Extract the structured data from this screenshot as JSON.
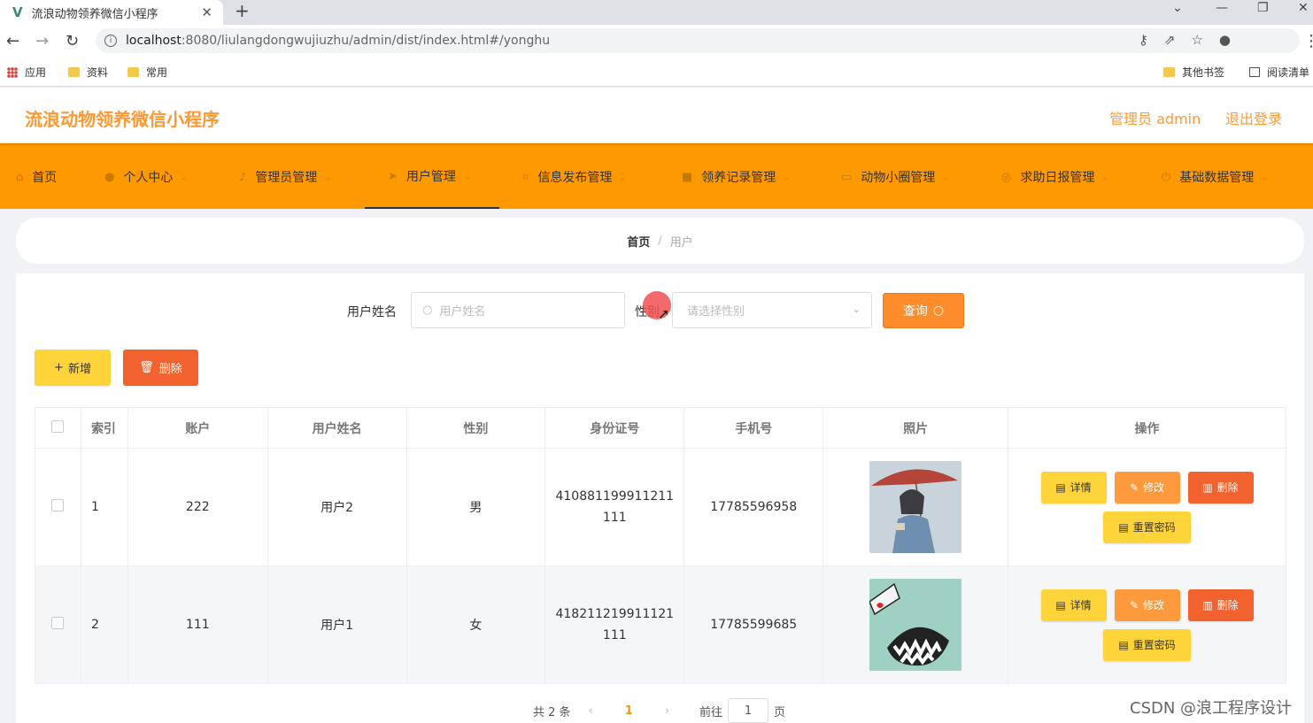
{
  "browser": {
    "tab_title": "流浪动物领养微信小程序",
    "url_host": "localhost",
    "url_rest": ":8080/liulangdongwujiuzhu/admin/dist/index.html#/yonghu",
    "bookmarks": [
      "应用",
      "资料",
      "常用",
      "其他书签",
      "阅读清单"
    ]
  },
  "header": {
    "app_title": "流浪动物领养微信小程序",
    "admin_label": "管理员 admin",
    "logout_label": "退出登录"
  },
  "menu": {
    "items": [
      "首页",
      "个人中心",
      "管理员管理",
      "用户管理",
      "信息发布管理",
      "领养记录管理",
      "动物小圈管理",
      "求助日报管理",
      "基础数据管理"
    ],
    "active": "用户管理"
  },
  "breadcrumb": {
    "home": "首页",
    "sep": "/",
    "current": "用户"
  },
  "search": {
    "name_label": "用户姓名",
    "name_placeholder": "用户姓名",
    "gender_label": "性别",
    "gender_placeholder": "请选择性别",
    "query_button": "查询"
  },
  "actions": {
    "add": "新增",
    "delete": "删除"
  },
  "table": {
    "headers": [
      "索引",
      "账户",
      "用户姓名",
      "性别",
      "身份证号",
      "手机号",
      "照片",
      "操作"
    ],
    "rows": [
      {
        "index": "1",
        "account": "222",
        "name": "用户2",
        "gender": "男",
        "id_line1": "410881199911211",
        "id_line2": "111",
        "phone": "17785596958"
      },
      {
        "index": "2",
        "account": "111",
        "name": "用户1",
        "gender": "女",
        "id_line1": "418211219911121",
        "id_line2": "111",
        "phone": "17785599685"
      }
    ],
    "op_labels": {
      "detail": "详情",
      "edit": "修改",
      "delete": "删除",
      "reset": "重置密码"
    }
  },
  "pagination": {
    "total": "共 2 条",
    "current": "1",
    "goto_label": "前往",
    "goto_value": "1",
    "page_label": "页"
  },
  "watermark": "CSDN @浪工程序设计",
  "colors": {
    "accent": "#ff9900",
    "title": "#ff9933",
    "danger": "#f2622e",
    "warning": "#ffd43b"
  }
}
